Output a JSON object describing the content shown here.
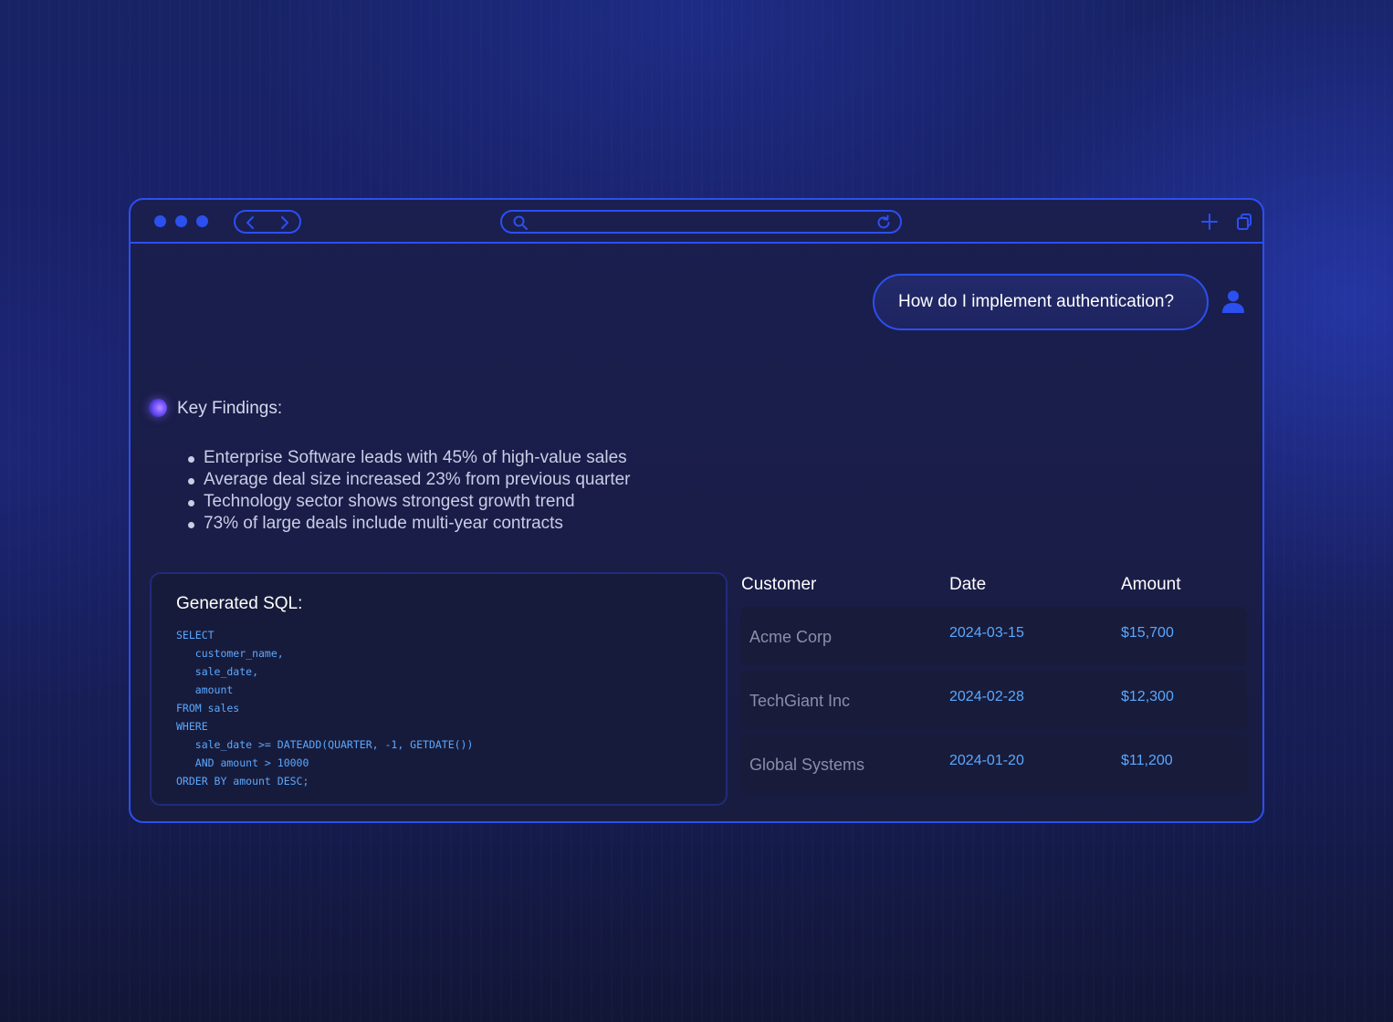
{
  "browser": {
    "nav": {
      "back_icon": "chevron-left-icon",
      "forward_icon": "chevron-right-icon"
    },
    "urlbar": {
      "search_icon": "search-icon",
      "reload_icon": "reload-icon"
    },
    "actions": {
      "new_tab_icon": "plus-icon",
      "tabs_icon": "copy-icon"
    }
  },
  "chat": {
    "user_message": "How do I implement authentication?",
    "assistant": {
      "findings_title": "Key Findings:",
      "findings": [
        "Enterprise Software leads with 45% of high-value sales",
        "Average deal size increased 23% from previous quarter",
        "Technology sector shows strongest growth trend",
        "73% of large deals include multi-year contracts"
      ]
    }
  },
  "sql": {
    "title": "Generated SQL:",
    "code": "SELECT\n   customer_name,\n   sale_date,\n   amount\nFROM sales\nWHERE\n   sale_date >= DATEADD(QUARTER, -1, GETDATE())\n   AND amount > 10000\nORDER BY amount DESC;"
  },
  "results": {
    "headers": [
      "Customer",
      "Date",
      "Amount"
    ],
    "rows": [
      {
        "customer": "Acme Corp",
        "date": "2024-03-15",
        "amount": "$15,700"
      },
      {
        "customer": "TechGiant Inc",
        "date": "2024-02-28",
        "amount": "$12,300"
      },
      {
        "customer": "Global Systems",
        "date": "2024-01-20",
        "amount": "$11,200"
      }
    ]
  },
  "colors": {
    "accent": "#2c4ff0",
    "code": "#5aa8ff",
    "background": "#1a1f4f"
  }
}
